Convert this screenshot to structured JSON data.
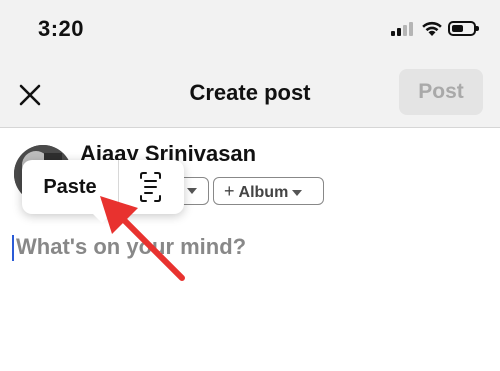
{
  "status_bar": {
    "time": "3:20",
    "signal_icon": "cellular-signal-icon",
    "wifi_icon": "wifi-icon",
    "battery_icon": "battery-icon",
    "battery_level": 0.55
  },
  "header": {
    "close_icon": "close-icon",
    "title": "Create post",
    "post_label": "Post"
  },
  "author": {
    "name": "Ajaay Srinivasan",
    "album_label": "Album",
    "plus_glyph": "+"
  },
  "composer": {
    "placeholder": "What's on your mind?"
  },
  "context_menu": {
    "paste_label": "Paste",
    "scan_icon": "scan-text-icon"
  },
  "annotation": {
    "arrow_color": "#e8322f"
  }
}
